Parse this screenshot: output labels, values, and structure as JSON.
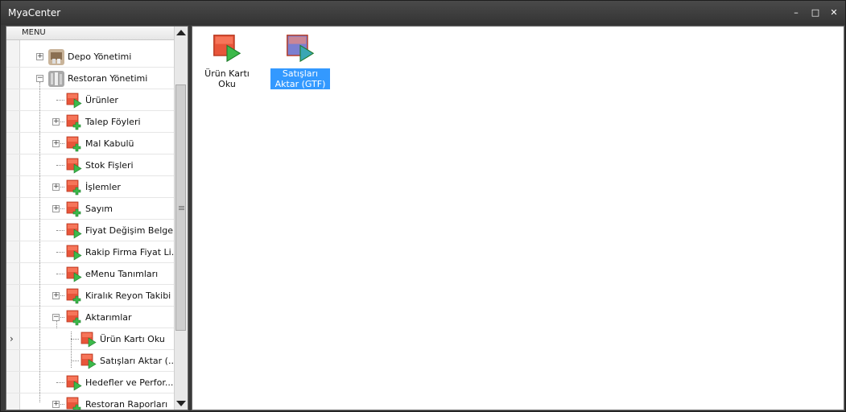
{
  "window": {
    "title": "MyaCenter",
    "minimize": "–",
    "maximize": "□",
    "close": "✕"
  },
  "tree": {
    "header": "MENU",
    "items": [
      {
        "label": "Depo Yönetimi",
        "icon": "warehouse-photo-icon",
        "expander": "+"
      },
      {
        "label": "Restoran Yönetimi",
        "icon": "restaurant-photo-icon",
        "expander": "-"
      },
      {
        "label": "Ürünler",
        "icon": "play-module-icon",
        "expander": ""
      },
      {
        "label": "Talep Föyleri",
        "icon": "add-module-icon",
        "expander": "+"
      },
      {
        "label": "Mal Kabulü",
        "icon": "add-module-icon",
        "expander": "+"
      },
      {
        "label": "Stok Fişleri",
        "icon": "play-module-icon",
        "expander": ""
      },
      {
        "label": "İşlemler",
        "icon": "add-module-icon",
        "expander": "+"
      },
      {
        "label": "Sayım",
        "icon": "add-module-icon",
        "expander": "+"
      },
      {
        "label": "Fiyat Değişim Belgeleri",
        "icon": "play-module-icon",
        "expander": ""
      },
      {
        "label": "Rakip Firma Fiyat Li...",
        "icon": "play-module-icon",
        "expander": ""
      },
      {
        "label": "eMenu Tanımları",
        "icon": "play-module-icon",
        "expander": ""
      },
      {
        "label": "Kiralık Reyon Takibi",
        "icon": "add-module-icon",
        "expander": "+"
      },
      {
        "label": "Aktarımlar",
        "icon": "add-module-icon",
        "expander": "-"
      },
      {
        "label": "Ürün Kartı Oku",
        "icon": "play-module-icon",
        "expander": ""
      },
      {
        "label": "Satışları Aktar (...",
        "icon": "play-module-icon",
        "expander": ""
      },
      {
        "label": "Hedefler ve Perfor...",
        "icon": "play-module-icon",
        "expander": ""
      },
      {
        "label": "Restoran Raporları",
        "icon": "add-module-icon",
        "expander": "+"
      }
    ],
    "current_row_marker": "›"
  },
  "content": {
    "tiles": [
      {
        "caption": "Ürün Kartı Oku",
        "icon": "play-module-icon",
        "selected": false
      },
      {
        "caption": "Satışları Aktar (GTF)",
        "icon": "play-module-icon",
        "selected": true
      }
    ]
  },
  "colors": {
    "module_icon": "#e8553a",
    "play_arrow": "#3cb94a",
    "selection": "#3399ff",
    "selected_icon": "#7b7fd0"
  }
}
